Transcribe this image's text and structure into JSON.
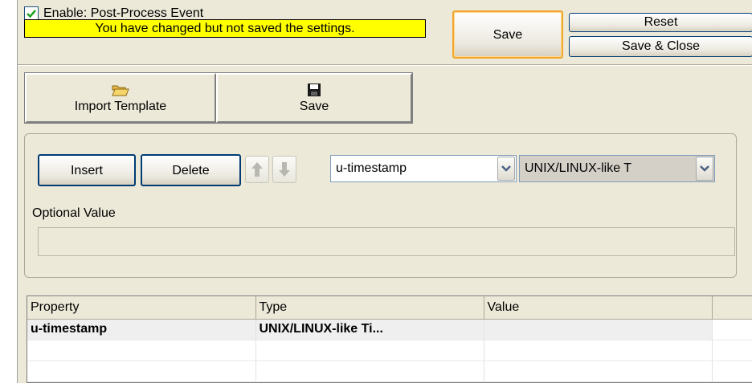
{
  "header": {
    "enable_label": "Enable: Post-Process Event",
    "enable_checked": true,
    "warning": "You have changed but not saved the settings.",
    "save_label": "Save",
    "reset_label": "Reset",
    "save_close_label": "Save & Close"
  },
  "toolbar": {
    "import_label": "Import Template",
    "import_icon": "folder-open-icon",
    "save_label": "Save",
    "save_icon": "floppy-disk-icon"
  },
  "editor": {
    "insert_label": "Insert",
    "delete_label": "Delete",
    "property_value": "u-timestamp",
    "type_value": "UNIX/LINUX-like T",
    "optional_label": "Optional Value",
    "optional_value": ""
  },
  "grid": {
    "columns": [
      "Property",
      "Type",
      "Value"
    ],
    "rows": [
      {
        "property": "u-timestamp",
        "type": "UNIX/LINUX-like Ti...",
        "value": ""
      },
      {
        "property": "",
        "type": "",
        "value": ""
      },
      {
        "property": "",
        "type": "",
        "value": ""
      }
    ]
  },
  "colors": {
    "warning_bg": "#ffff00",
    "panel_bg": "#ece9d8",
    "focus_border": "#f2a62e"
  }
}
